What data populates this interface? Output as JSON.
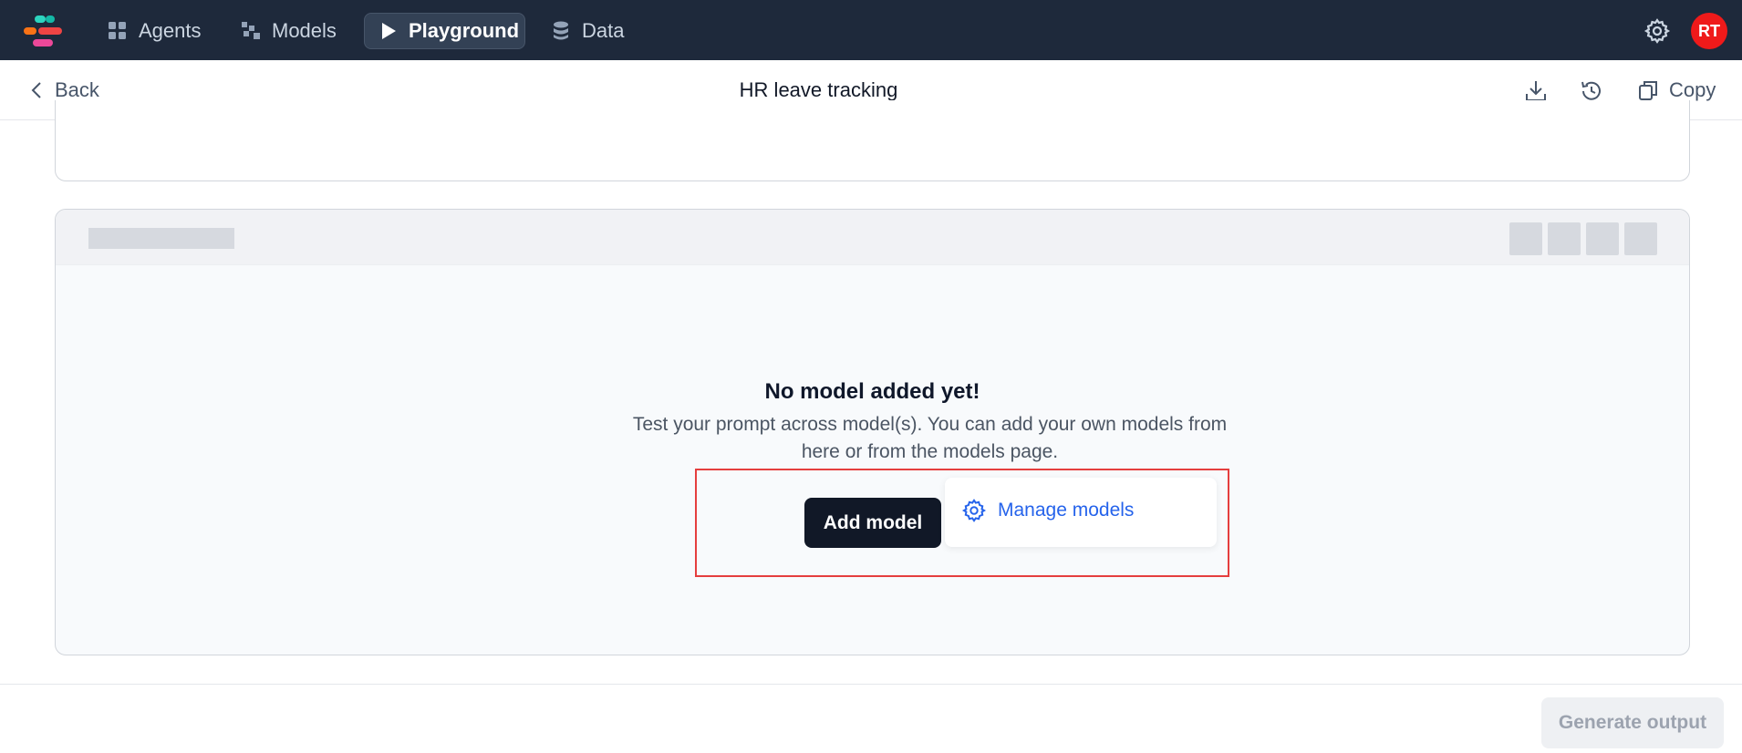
{
  "topnav": {
    "items": [
      {
        "label": "Agents",
        "icon": "grid-icon"
      },
      {
        "label": "Models",
        "icon": "models-icon"
      },
      {
        "label": "Playground",
        "icon": "play-icon",
        "active": true
      },
      {
        "label": "Data",
        "icon": "database-icon"
      }
    ],
    "avatar_initials": "RT",
    "avatar_color": "#ef1a1a"
  },
  "subheader": {
    "back_label": "Back",
    "title": "HR leave tracking",
    "copy_label": "Copy"
  },
  "panel": {
    "empty_title": "No model added yet!",
    "empty_desc_line1": "Test your prompt across model(s). You can add your own models from",
    "empty_desc_line2": "here or from the models page."
  },
  "actions": {
    "add_model_label": "Add model",
    "manage_models_label": "Manage models"
  },
  "footer": {
    "generate_label": "Generate output"
  },
  "colors": {
    "nav_bg": "#1e293b",
    "primary_dark": "#111827",
    "link_blue": "#2563eb",
    "highlight_red": "#e53e3e"
  }
}
